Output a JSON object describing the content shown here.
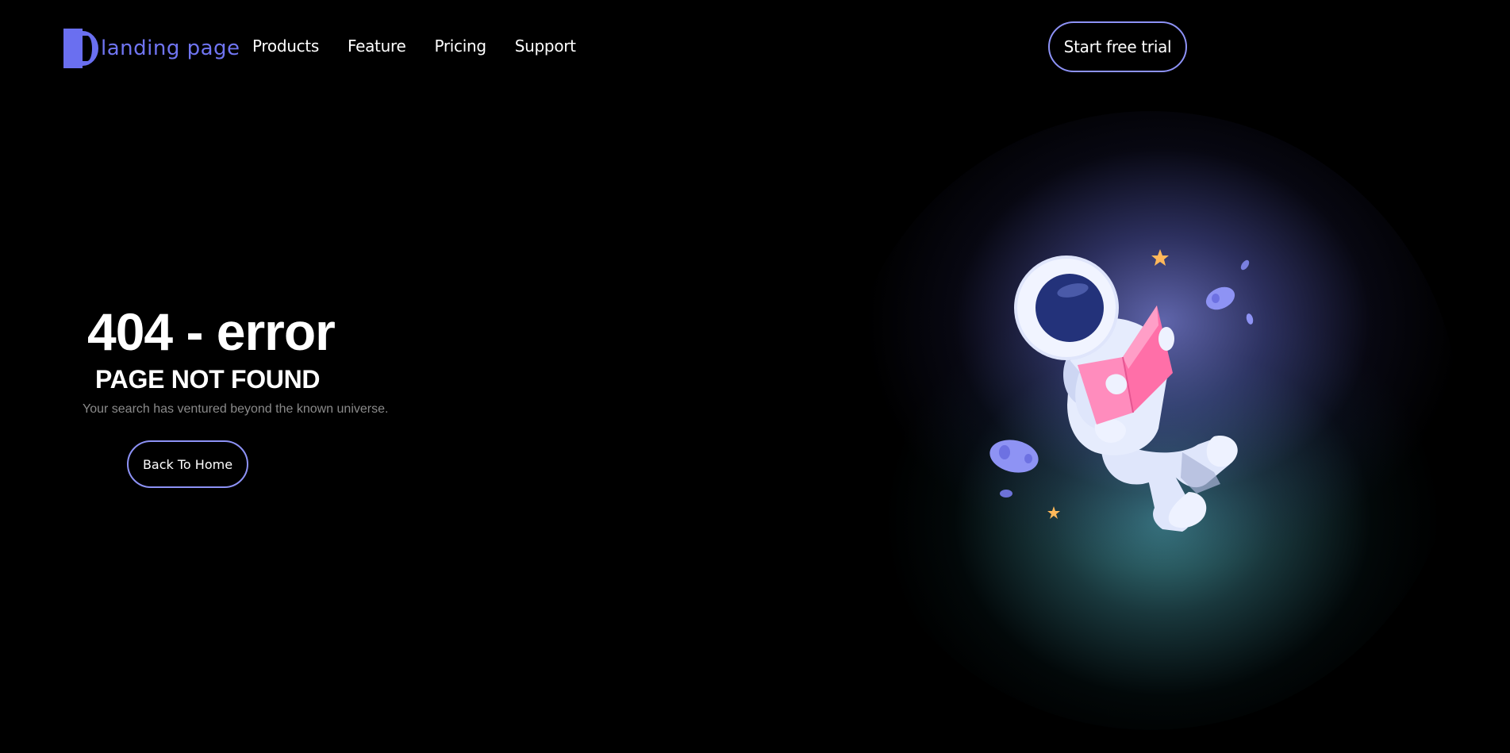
{
  "header": {
    "logo_text": "landing page",
    "nav": [
      "Products",
      "Feature",
      "Pricing",
      "Support"
    ],
    "cta_label": "Start free trial"
  },
  "hero": {
    "title": "404 - error",
    "subtitle": "PAGE NOT FOUND",
    "description": "Your search has ventured beyond the known universe.",
    "button_label": "Back To Home"
  },
  "colors": {
    "accent": "#6a6ff0",
    "button_border": "#8d92f6",
    "background": "#000000",
    "book": "#ff7bb0",
    "star": "#ffb85a"
  },
  "icons": {
    "logo": "logo-mark-icon",
    "illustration": "astronaut-reading-icon"
  }
}
